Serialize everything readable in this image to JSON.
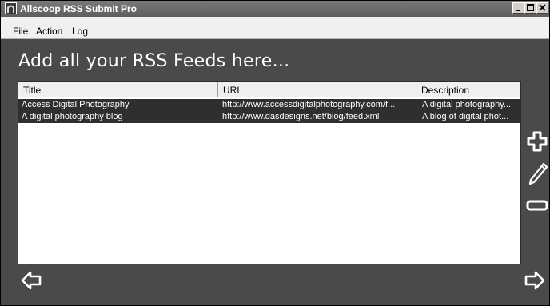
{
  "window": {
    "title": "Allscoop RSS Submit Pro"
  },
  "menu": [
    "File",
    "Action",
    "Log"
  ],
  "heading": "Add all your RSS Feeds here...",
  "columns": {
    "title": "Title",
    "url": "URL",
    "description": "Description"
  },
  "rows": [
    {
      "title": "Access Digital Photography",
      "url": "http://www.accessdigitalphotography.com/f...",
      "description": "A digital photography..."
    },
    {
      "title": "A digital photography blog",
      "url": "http://www.dasdesigns.net/blog/feed.xml",
      "description": "A blog of digital phot..."
    }
  ],
  "icons": {
    "app": "app-logo-icon",
    "add": "plus-icon",
    "edit": "pencil-icon",
    "remove": "minus-icon",
    "back": "arrow-left-icon",
    "next": "arrow-right-icon"
  },
  "colors": {
    "background": "#4a4a4a",
    "row_selected": "#2f2f2f",
    "text_light": "#ffffff"
  }
}
